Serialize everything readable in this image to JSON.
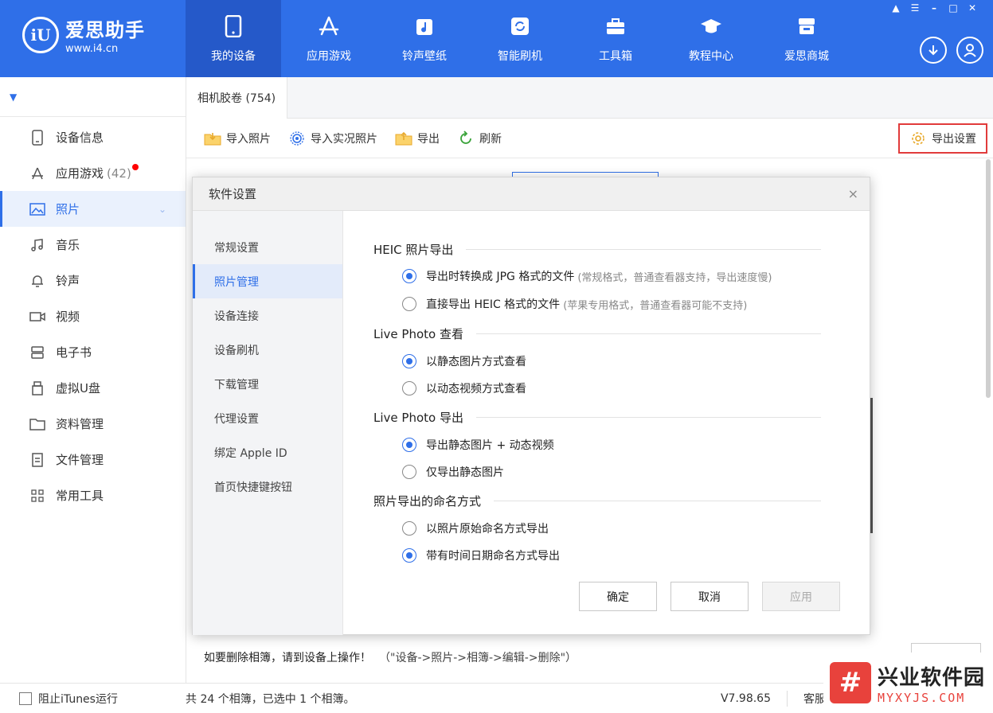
{
  "app": {
    "name": "爱思助手",
    "url": "www.i4.cn",
    "logo_mark": "iU"
  },
  "nav": [
    {
      "label": "我的设备",
      "icon": "phone-icon"
    },
    {
      "label": "应用游戏",
      "icon": "appstore-icon"
    },
    {
      "label": "铃声壁纸",
      "icon": "music-note-icon"
    },
    {
      "label": "智能刷机",
      "icon": "refresh-icon"
    },
    {
      "label": "工具箱",
      "icon": "toolbox-icon"
    },
    {
      "label": "教程中心",
      "icon": "graduation-cap-icon"
    },
    {
      "label": "爱思商城",
      "icon": "shop-icon"
    }
  ],
  "sidebar": {
    "items": [
      {
        "label": "设备信息",
        "icon": "device-info-icon"
      },
      {
        "label": "应用游戏",
        "count": "(42)",
        "icon": "appstore-icon"
      },
      {
        "label": "照片",
        "icon": "photo-icon"
      },
      {
        "label": "音乐",
        "icon": "music-icon"
      },
      {
        "label": "铃声",
        "icon": "bell-icon"
      },
      {
        "label": "视频",
        "icon": "video-icon"
      },
      {
        "label": "电子书",
        "icon": "book-icon"
      },
      {
        "label": "虚拟U盘",
        "icon": "usb-icon"
      },
      {
        "label": "资料管理",
        "icon": "folder-icon"
      },
      {
        "label": "文件管理",
        "icon": "file-icon"
      },
      {
        "label": "常用工具",
        "icon": "grid-icon"
      }
    ]
  },
  "tabs": {
    "active": "相机胶卷 (754)"
  },
  "toolbar": {
    "import_photos": "导入照片",
    "import_live": "导入实况照片",
    "export": "导出",
    "refresh": "刷新",
    "export_settings": "导出设置"
  },
  "dialog": {
    "title": "软件设置",
    "close": "×",
    "nav": [
      "常规设置",
      "照片管理",
      "设备连接",
      "设备刷机",
      "下载管理",
      "代理设置",
      "绑定 Apple ID",
      "首页快捷键按钮"
    ],
    "sections": {
      "heic": {
        "title": "HEIC 照片导出",
        "opt1": "导出时转换成 JPG 格式的文件",
        "opt1_hint": "(常规格式，普通查看器支持，导出速度慢)",
        "opt2": "直接导出 HEIC 格式的文件",
        "opt2_hint": "(苹果专用格式，普通查看器可能不支持)"
      },
      "live_view": {
        "title": "Live Photo 查看",
        "opt1": "以静态图片方式查看",
        "opt2": "以动态视频方式查看"
      },
      "live_export": {
        "title": "Live Photo 导出",
        "opt1": "导出静态图片 + 动态视频",
        "opt2": "仅导出静态图片"
      },
      "naming": {
        "title": "照片导出的命名方式",
        "opt1": "以照片原始命名方式导出",
        "opt2": "带有时间日期命名方式导出"
      }
    },
    "buttons": {
      "ok": "确定",
      "cancel": "取消",
      "apply": "应用"
    }
  },
  "notice": {
    "text": "如要删除相簿，请到设备上操作！",
    "path": "（\"设备->照片->相簿->编辑->删除\"）"
  },
  "status": {
    "itunes": "阻止iTunes运行",
    "albums": "共 24 个相簿，已选中 1 个相簿。",
    "version": "V7.98.65",
    "service": "客服"
  },
  "watermark": {
    "name": "兴业软件园",
    "url": "MYXYJS.COM"
  },
  "colors": {
    "brand": "#2f6fe8",
    "highlight_border": "#e13b3b"
  }
}
